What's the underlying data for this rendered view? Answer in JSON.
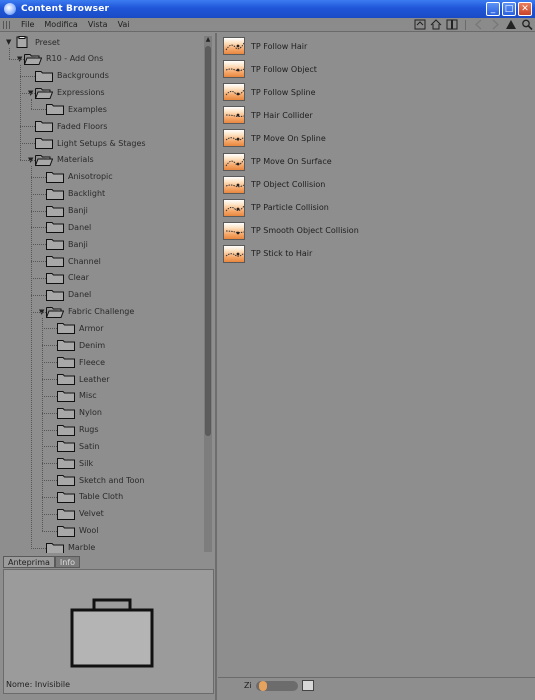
{
  "window": {
    "title": "Content Browser"
  },
  "menu": {
    "items": [
      "File",
      "Modifica",
      "Vista",
      "Vai"
    ]
  },
  "toolbar": {
    "icons": [
      "refresh-icon",
      "home-icon",
      "bookmark-icon",
      "back-icon",
      "forward-icon",
      "up-icon",
      "search-icon"
    ]
  },
  "tree": {
    "rows": [
      {
        "label": "Preset",
        "depth": 0,
        "expanded": true,
        "kind": "root"
      },
      {
        "label": "R10 - Add Ons",
        "depth": 1,
        "expanded": true
      },
      {
        "label": "Backgrounds",
        "depth": 2
      },
      {
        "label": "Expressions",
        "depth": 2,
        "expanded": true
      },
      {
        "label": "Examples",
        "depth": 3
      },
      {
        "label": "Faded Floors",
        "depth": 2
      },
      {
        "label": "Light Setups & Stages",
        "depth": 2
      },
      {
        "label": "Materials",
        "depth": 2,
        "expanded": true
      },
      {
        "label": "Anisotropic",
        "depth": 3
      },
      {
        "label": "Backlight",
        "depth": 3
      },
      {
        "label": "Banji",
        "depth": 3
      },
      {
        "label": "Danel",
        "depth": 3
      },
      {
        "label": "Banji",
        "depth": 3
      },
      {
        "label": "Channel",
        "depth": 3
      },
      {
        "label": "Clear",
        "depth": 3
      },
      {
        "label": "Danel",
        "depth": 3
      },
      {
        "label": "Fabric Challenge",
        "depth": 3,
        "expanded": true
      },
      {
        "label": "Armor",
        "depth": 4
      },
      {
        "label": "Denim",
        "depth": 4
      },
      {
        "label": "Fleece",
        "depth": 4
      },
      {
        "label": "Leather",
        "depth": 4
      },
      {
        "label": "Misc",
        "depth": 4
      },
      {
        "label": "Nylon",
        "depth": 4
      },
      {
        "label": "Rugs",
        "depth": 4
      },
      {
        "label": "Satin",
        "depth": 4
      },
      {
        "label": "Silk",
        "depth": 4
      },
      {
        "label": "Sketch and Toon",
        "depth": 4
      },
      {
        "label": "Table Cloth",
        "depth": 4
      },
      {
        "label": "Velvet",
        "depth": 4
      },
      {
        "label": "Wool",
        "depth": 4
      },
      {
        "label": "Marble",
        "depth": 3
      }
    ]
  },
  "preview": {
    "tabs": [
      "Anteprima",
      "Info"
    ],
    "status": "Nome: Invisibile"
  },
  "content": {
    "items": [
      "TP Follow Hair",
      "TP Follow Object",
      "TP Follow Spline",
      "TP Hair Collider",
      "TP Move On Spline",
      "TP Move On Surface",
      "TP Object Collision",
      "TP Particle Collision",
      "TP Smooth Object Collision",
      "TP Stick to Hair"
    ]
  },
  "bottom": {
    "zoom_label": "Zi",
    "zoom_level": 0.1
  },
  "colors": {
    "panel_bg": "#8e8e8e",
    "thumb_orange": "#f6a86a",
    "titlebar_blue": "#1f56d8"
  }
}
